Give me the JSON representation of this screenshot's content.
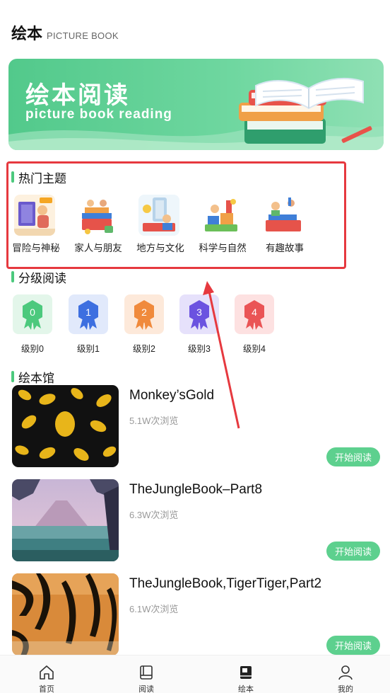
{
  "header": {
    "title": "绘本",
    "subtitle": "PICTURE BOOK"
  },
  "banner": {
    "title": "绘本阅读",
    "subtitle": "picture book reading"
  },
  "hot_topics": {
    "title": "热门主题",
    "items": [
      {
        "label": "冒险与神秘"
      },
      {
        "label": "家人与朋友"
      },
      {
        "label": "地方与文化"
      },
      {
        "label": "科学与自然"
      },
      {
        "label": "有趣故事"
      }
    ]
  },
  "levels": {
    "title": "分级阅读",
    "items": [
      {
        "number": "0",
        "label": "级别0",
        "color": "#4cc97d",
        "bg": "#e3f6ea"
      },
      {
        "number": "1",
        "label": "级别1",
        "color": "#3d6fe0",
        "bg": "#e1e9fb"
      },
      {
        "number": "2",
        "label": "级别2",
        "color": "#f08a3c",
        "bg": "#fde9da"
      },
      {
        "number": "3",
        "label": "级别3",
        "color": "#6b52e0",
        "bg": "#e6e1fb"
      },
      {
        "number": "4",
        "label": "级别4",
        "color": "#ea5455",
        "bg": "#fde1e1"
      }
    ]
  },
  "library": {
    "title": "绘本馆",
    "read_label": "开始阅读",
    "books": [
      {
        "title": "Monkey’sGold",
        "views": "5.1W次浏览"
      },
      {
        "title": "TheJungleBook–Part8",
        "views": "6.3W次浏览"
      },
      {
        "title": "TheJungleBook,TigerTiger,Part2",
        "views": "6.1W次浏览"
      }
    ]
  },
  "tabbar": {
    "items": [
      {
        "label": "首页",
        "icon": "home-icon"
      },
      {
        "label": "阅读",
        "icon": "book-icon"
      },
      {
        "label": "绘本",
        "icon": "picture-book-icon",
        "active": true
      },
      {
        "label": "我的",
        "icon": "user-icon"
      }
    ]
  },
  "colors": {
    "accent": "#4cc97d",
    "button": "#5dd08e",
    "highlight": "#e6393f"
  }
}
